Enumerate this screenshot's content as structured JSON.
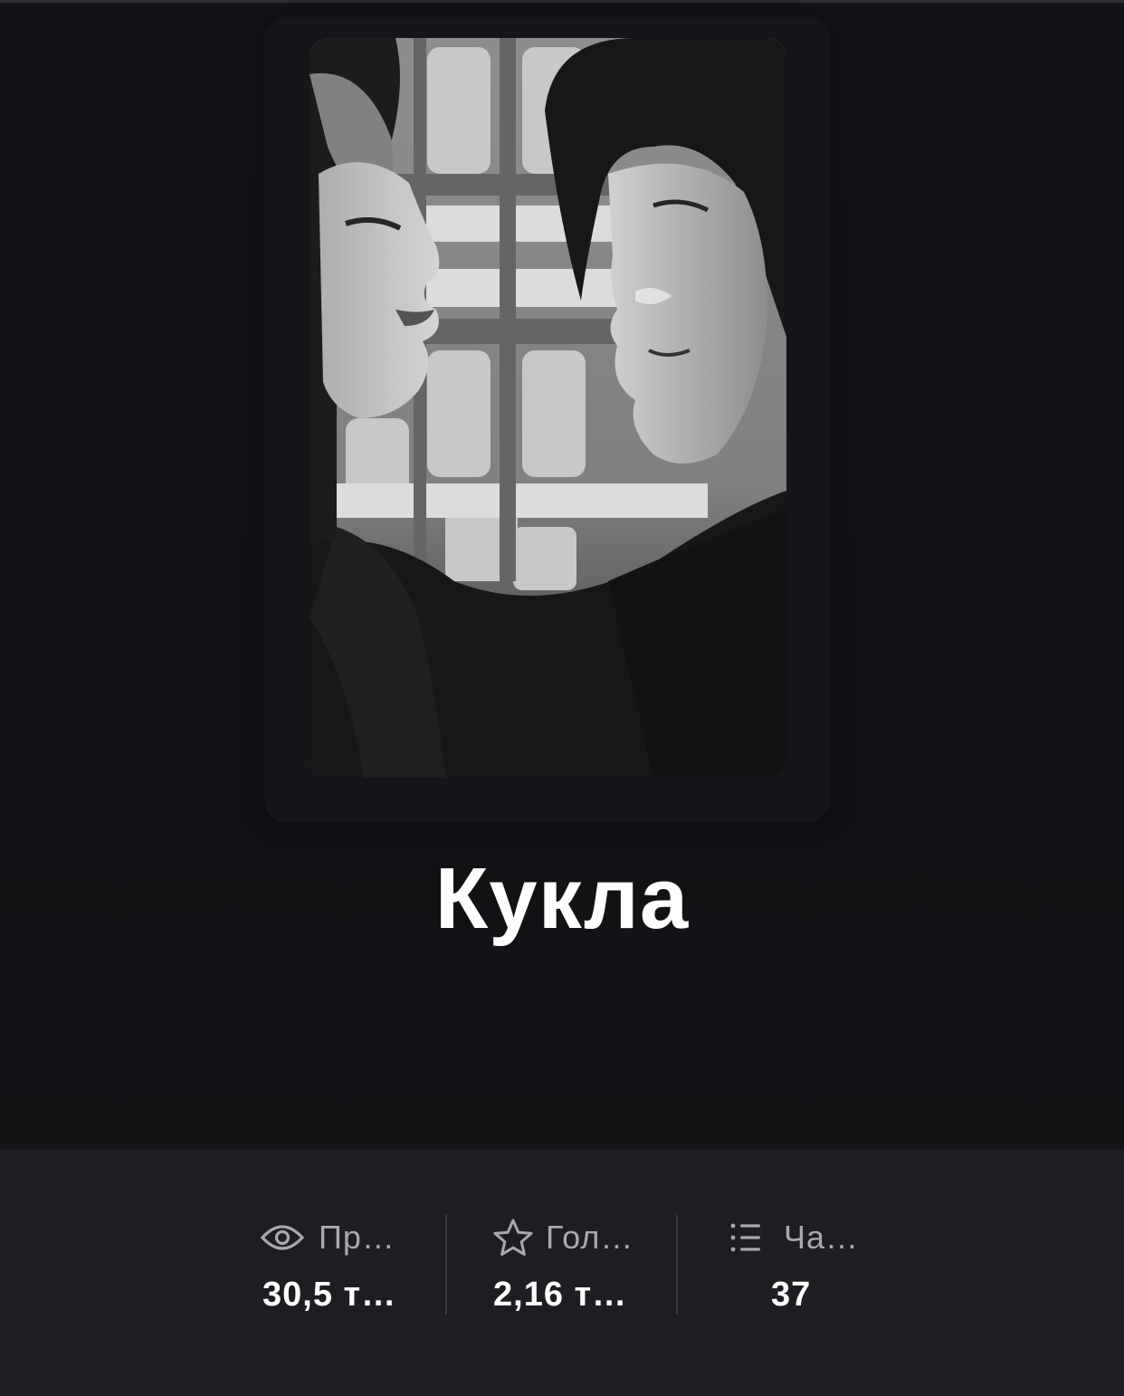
{
  "story": {
    "title": "Кукла",
    "cover_alt": "cover-image"
  },
  "stats": {
    "reads": {
      "icon": "eye-icon",
      "label": "Пр…",
      "value": "30,5 т…"
    },
    "votes": {
      "icon": "star-icon",
      "label": "Гол…",
      "value": "2,16 т…"
    },
    "parts": {
      "icon": "list-icon",
      "label": "Ча…",
      "value": "37"
    }
  },
  "colors": {
    "background": "#1b1a1e",
    "hero_background": "#131216",
    "stats_background": "#1e1d21",
    "title_text": "#ffffff",
    "label_text": "#a9a8ae",
    "value_text": "#ffffff",
    "divider": "#3a393f"
  }
}
